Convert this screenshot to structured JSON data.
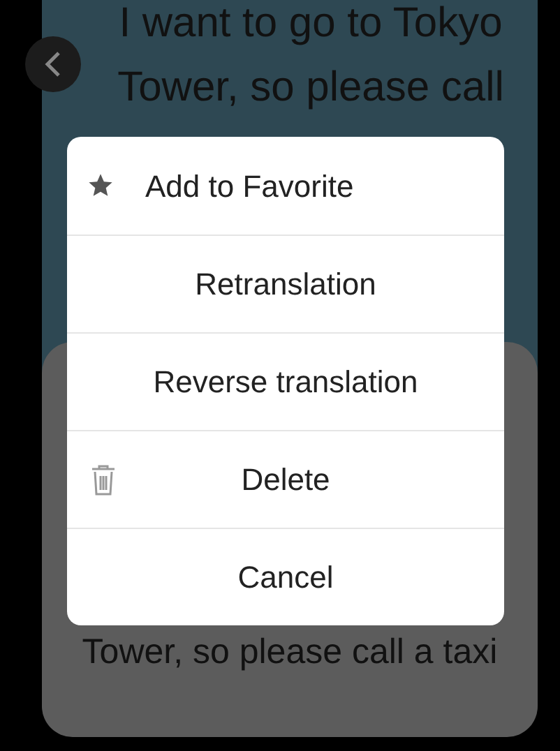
{
  "source_card": {
    "text": "I want to go to Tokyo Tower, so please call"
  },
  "result_card": {
    "text": "Tower, so please call a taxi"
  },
  "menu": {
    "items": [
      {
        "label": "Add to Favorite",
        "kind": "favorite"
      },
      {
        "label": "Retranslation",
        "kind": "plain"
      },
      {
        "label": "Reverse translation",
        "kind": "plain"
      },
      {
        "label": "Delete",
        "kind": "delete"
      },
      {
        "label": "Cancel",
        "kind": "plain"
      }
    ]
  }
}
